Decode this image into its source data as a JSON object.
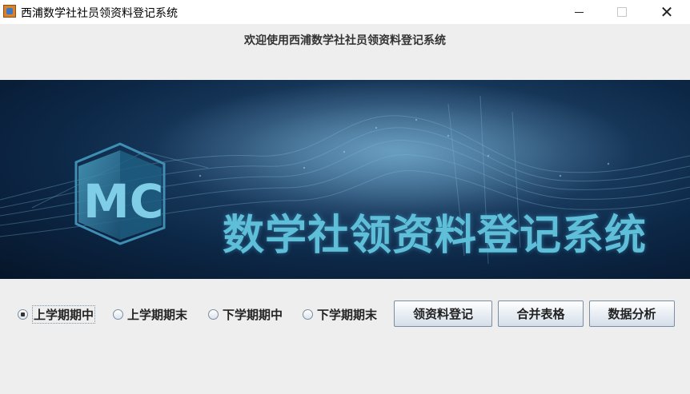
{
  "window": {
    "title": "西浦数学社社员领资料登记系统",
    "icon": "java-cup-icon"
  },
  "heading": "欢迎使用西浦数学社社员领资料登记系统",
  "banner": {
    "logo_text": "MC",
    "title": "数学社领资料登记系统",
    "accent_color": "#5fbfd8"
  },
  "radios": [
    {
      "label": "上学期期中",
      "checked": true
    },
    {
      "label": "上学期期末",
      "checked": false
    },
    {
      "label": "下学期期中",
      "checked": false
    },
    {
      "label": "下学期期末",
      "checked": false
    }
  ],
  "buttons": [
    {
      "label": "领资料登记"
    },
    {
      "label": "合并表格"
    },
    {
      "label": "数据分析"
    }
  ]
}
